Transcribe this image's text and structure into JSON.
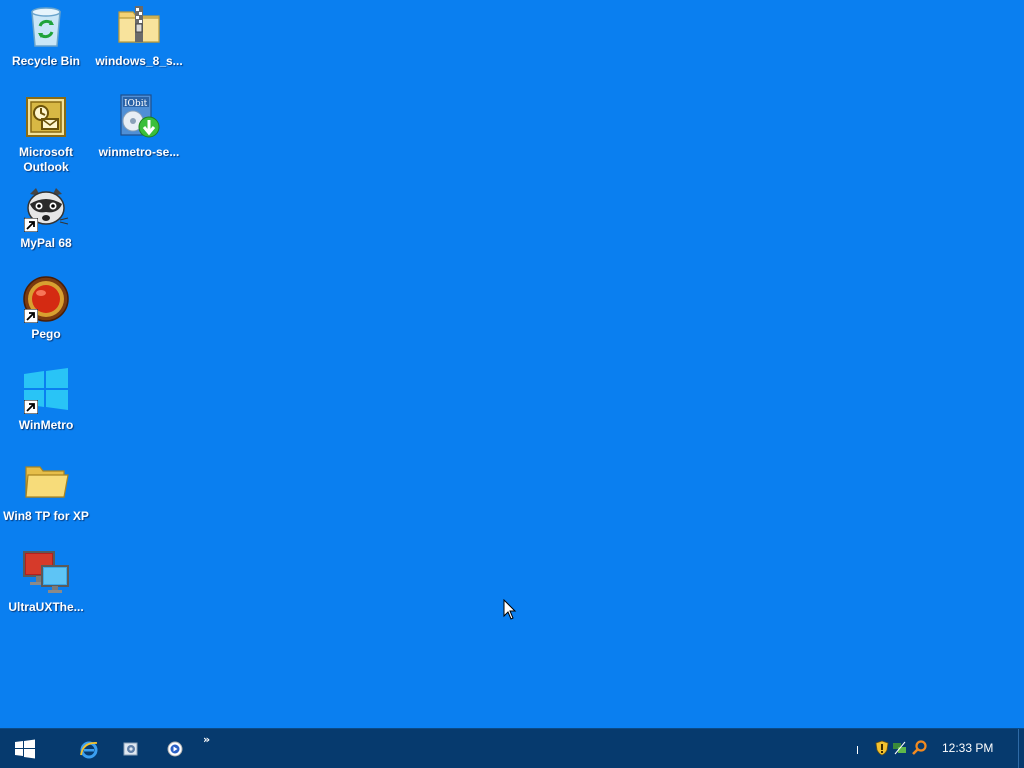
{
  "desktop": {
    "icons": [
      {
        "label": "Recycle Bin",
        "icon": "recycle-bin-icon"
      },
      {
        "label": "windows_8_s...",
        "icon": "zip-folder-icon"
      },
      {
        "label": "Microsoft Outlook",
        "icon": "outlook-icon"
      },
      {
        "label": "winmetro-se...",
        "icon": "iobit-installer-icon"
      },
      {
        "label": "MyPal 68",
        "icon": "mypal-raccoon-icon"
      },
      {
        "label": "Pego",
        "icon": "pego-icon"
      },
      {
        "label": "WinMetro",
        "icon": "windows-logo-icon"
      },
      {
        "label": "Win8 TP for XP",
        "icon": "folder-icon"
      },
      {
        "label": "UltraUXThe...",
        "icon": "monitor-icon"
      }
    ]
  },
  "taskbar": {
    "start": "windows-start-icon",
    "quick_launch": [
      "internet-explorer-icon",
      "settings-app-icon",
      "media-player-icon"
    ],
    "overflow": "»",
    "tray_icons": [
      "security-shield-icon",
      "network-icon",
      "search-tray-icon"
    ],
    "clock": "12:33 PM"
  },
  "colors": {
    "desktop_bg": "#0a7ff0",
    "taskbar_bg": "#063a6e"
  }
}
